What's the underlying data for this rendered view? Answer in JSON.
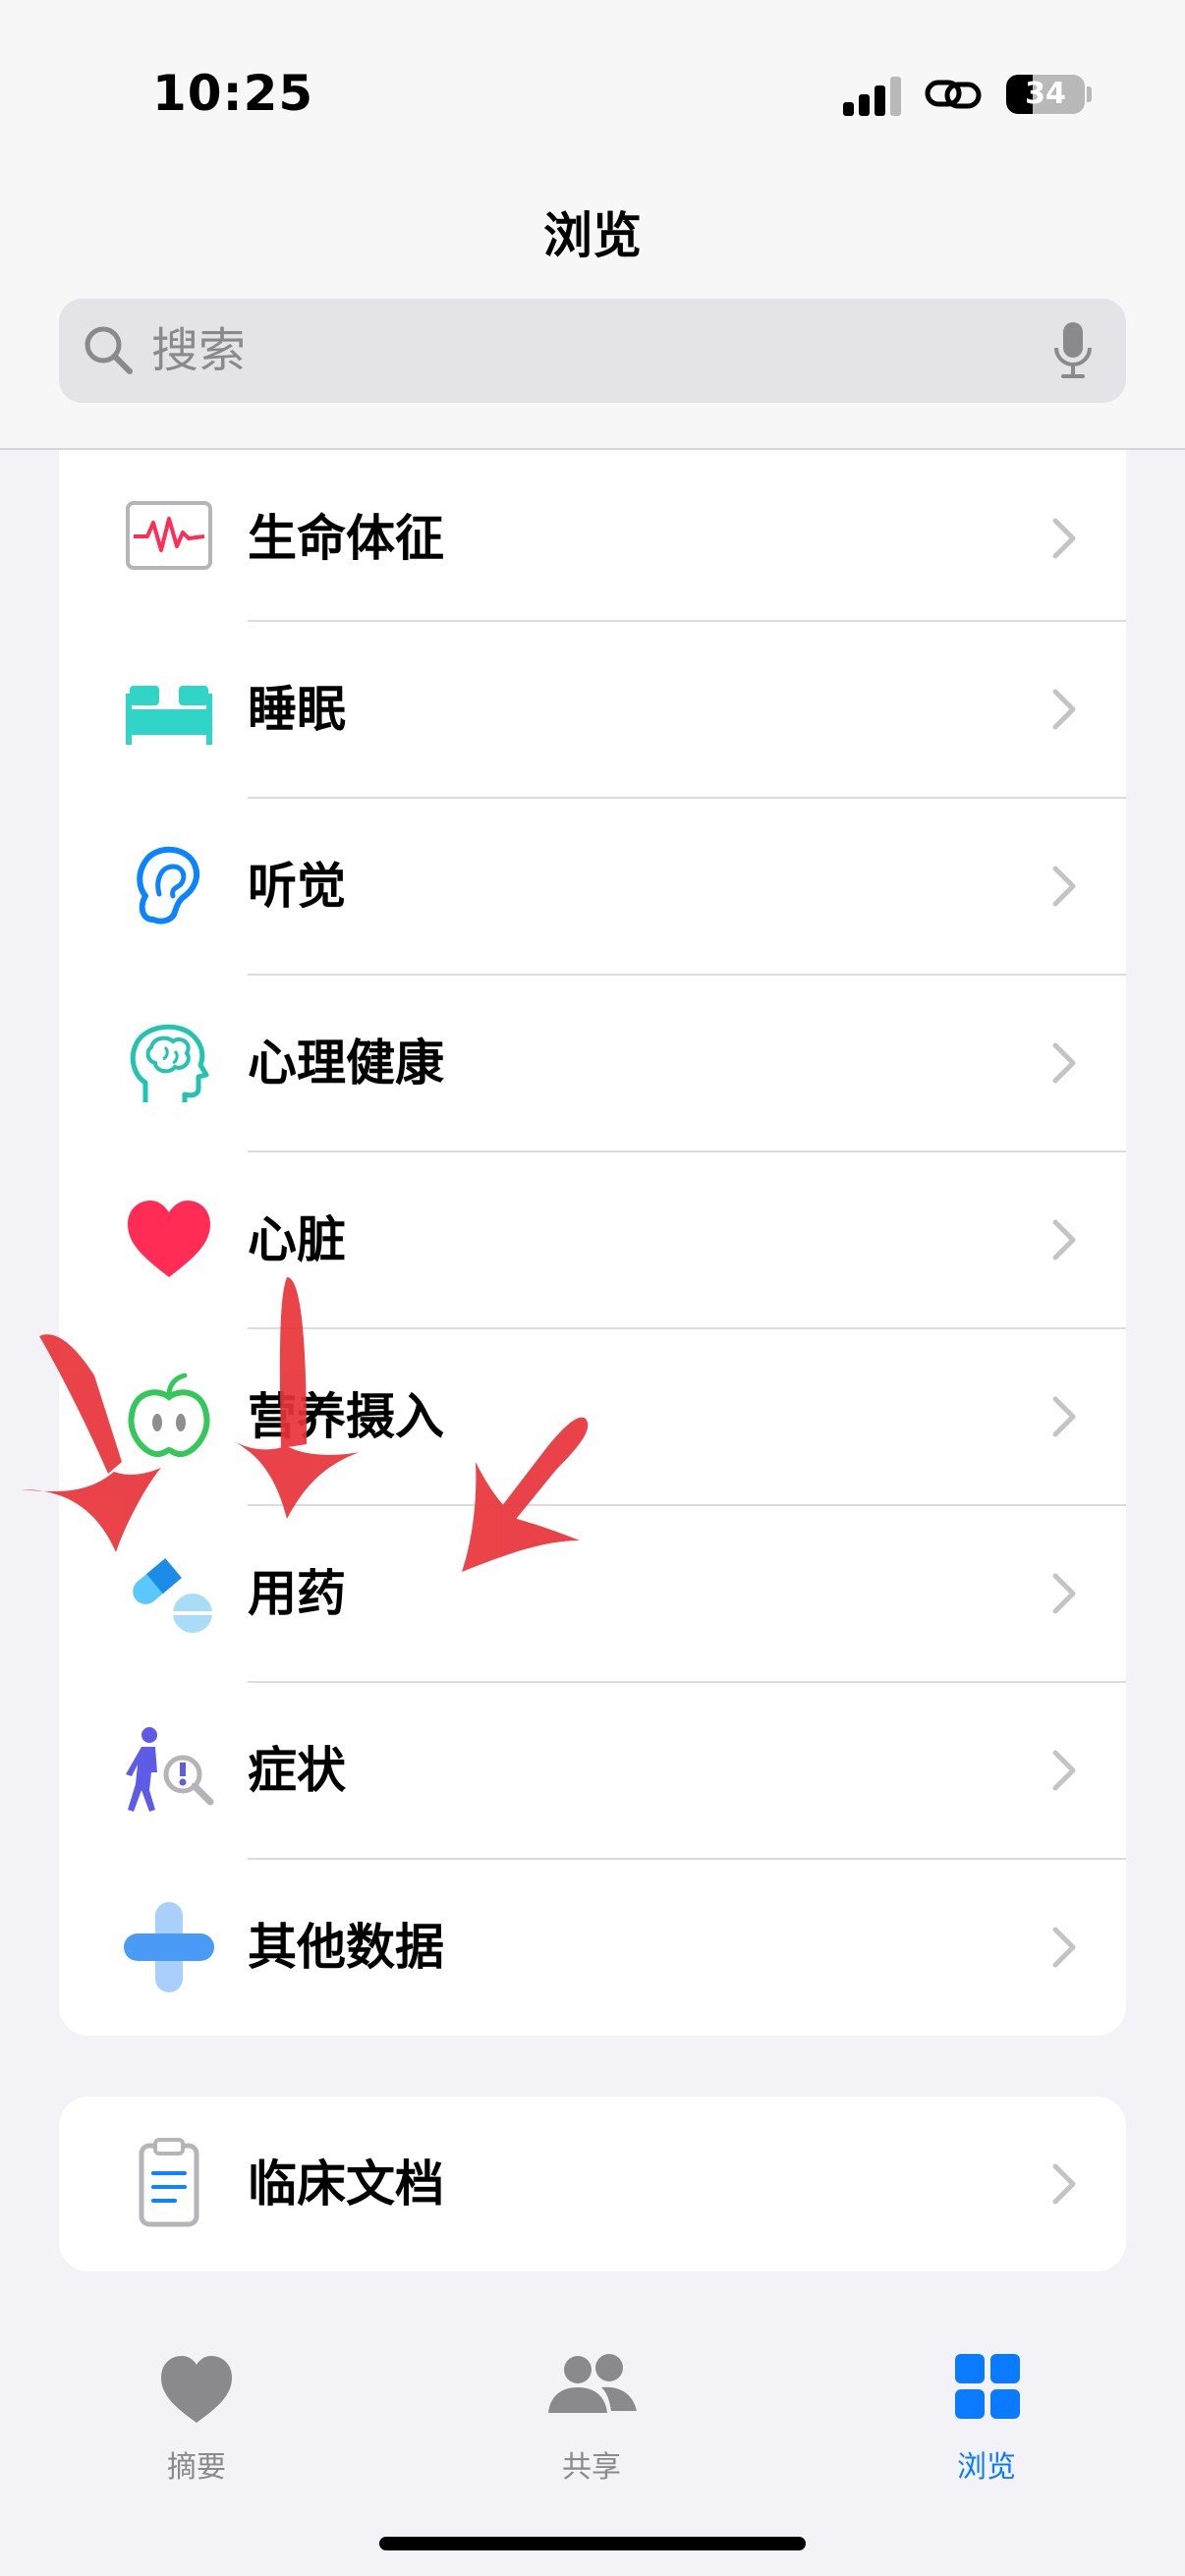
{
  "status_bar": {
    "time": "10:25",
    "battery_level": "34",
    "battery_fraction": 0.34,
    "icons": [
      "cellular-signal-icon",
      "link-icon",
      "battery-icon"
    ]
  },
  "nav": {
    "title": "浏览"
  },
  "search": {
    "placeholder": "搜索",
    "icons": [
      "magnifier-icon",
      "microphone-icon"
    ]
  },
  "categories": [
    {
      "label": "生命体征",
      "icon": "vital-signs-icon",
      "color": "#ff2d55"
    },
    {
      "label": "睡眠",
      "icon": "bed-icon",
      "color": "#30d5c8"
    },
    {
      "label": "听觉",
      "icon": "ear-icon",
      "color": "#0a84ff"
    },
    {
      "label": "心理健康",
      "icon": "mind-head-icon",
      "color": "#20c4b0"
    },
    {
      "label": "心脏",
      "icon": "heart-icon",
      "color": "#ff2d55"
    },
    {
      "label": "营养摄入",
      "icon": "apple-icon",
      "color": "#34c759"
    },
    {
      "label": "用药",
      "icon": "pills-icon",
      "color": "#5ac8fa"
    },
    {
      "label": "症状",
      "icon": "person-magnifier-icon",
      "color": "#5e5ce6"
    },
    {
      "label": "其他数据",
      "icon": "plus-icon",
      "color": "#0a84ff"
    }
  ],
  "clinical": {
    "label": "临床文档",
    "icon": "clipboard-icon",
    "color": "#0a84ff"
  },
  "tabs": [
    {
      "label": "摘要",
      "icon": "heart-tab-icon",
      "active": false
    },
    {
      "label": "共享",
      "icon": "people-tab-icon",
      "active": false
    },
    {
      "label": "浏览",
      "icon": "grid-tab-icon",
      "active": true
    }
  ],
  "colors": {
    "accent": "#0a7aff",
    "annotation_arrows": "#e8343a"
  }
}
